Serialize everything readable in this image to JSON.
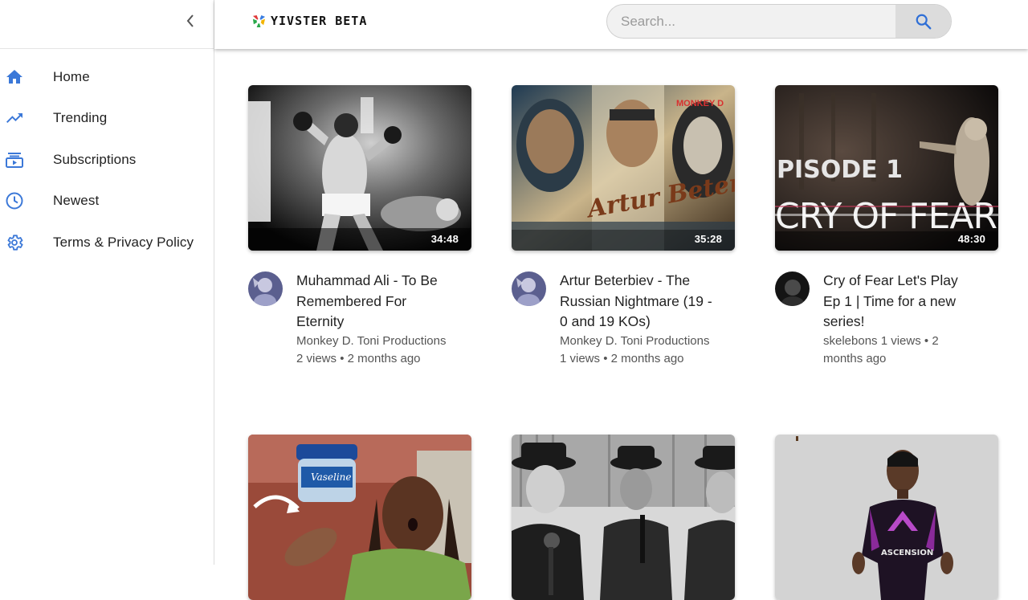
{
  "app": {
    "name": "YIVSTER BETA"
  },
  "sidebar": {
    "items": [
      {
        "label": "Home",
        "icon": "home-icon"
      },
      {
        "label": "Trending",
        "icon": "trending-icon"
      },
      {
        "label": "Subscriptions",
        "icon": "subscriptions-icon"
      },
      {
        "label": "Newest",
        "icon": "clock-icon"
      },
      {
        "label": "Terms & Privacy Policy",
        "icon": "gear-icon"
      }
    ]
  },
  "search": {
    "placeholder": "Search...",
    "value": ""
  },
  "colors": {
    "accent": "#2f6fd6",
    "icon": "#3b78d8",
    "search_bg": "#f1f1f1",
    "search_button_bg": "#dcdcdc"
  },
  "videos": [
    {
      "title": "Muhammad Ali - To Be Remembered For Eternity",
      "channel": "Monkey D. Toni Productions",
      "views": "2 views",
      "age": "2 months ago",
      "duration": "34:48"
    },
    {
      "title": "Artur Beterbiev - The Russian Nightmare (19 - 0 and 19 KOs)",
      "channel": "Monkey D. Toni Productions",
      "views": "1 views",
      "age": "2 months ago",
      "duration": "35:28",
      "thumb_text": "Artur Beterbiev",
      "brand": "MONKEY D"
    },
    {
      "title": "Cry of Fear Let's Play Ep 1 | Time for a new series!",
      "channel": "skelebons",
      "views": "1 views",
      "age": "2 months ago",
      "duration": "48:30",
      "thumb_text": [
        "PISODE 1",
        "CRY OF FEAR"
      ]
    },
    {
      "title": "",
      "thumb_text": "Vaseline"
    },
    {
      "title": ""
    },
    {
      "title": "",
      "thumb_text": "ASCENSION"
    }
  ]
}
